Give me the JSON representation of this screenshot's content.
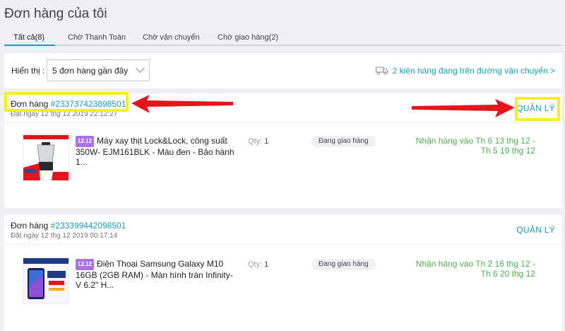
{
  "page": {
    "title": "Đơn hàng của tôi"
  },
  "tabs": [
    {
      "label": "Tất cả(8)"
    },
    {
      "label": "Chờ Thanh Toán"
    },
    {
      "label": "Chờ vận chuyển"
    },
    {
      "label": "Chờ giao hàng(2)"
    }
  ],
  "filter": {
    "label": "Hiển thị :",
    "selected": "5 đơn hàng gần đây",
    "shipping_status": "2 kiện hàng đang trên đường vận chuyển >"
  },
  "orders": [
    {
      "label": "Đơn hàng",
      "id": "#233737423898501",
      "date": "Đặt ngày 12 thg 12 2019 22:12:27",
      "manage": "QUẢN LÝ",
      "item": {
        "badge": "12.12",
        "title": "Máy xay thịt Lock&Lock, công suất 350W- EJM161BLK - Màu đen - Bảo hành 1...",
        "qty_label": "Qty:",
        "qty": "1",
        "status": "Đang giao hàng",
        "delivery": "Nhận hàng vào Th 6 13 thg 12 - Th 5 19 thg 12"
      }
    },
    {
      "label": "Đơn hàng",
      "id": "#233399442098501",
      "date": "Đặt ngày 12 thg 12 2019 00:17:14",
      "manage": "QUẢN LÝ",
      "item": {
        "badge": "12.12",
        "title": "Điện Thoại Samsung Galaxy M10 16GB (2GB RAM) - Màn hình tràn Infinity-V 6.2\" H...",
        "qty_label": "Qty:",
        "qty": "1",
        "status": "Đang giao hàng",
        "delivery": "Nhận hàng vào Th 2 16 thg 12 - Th 6 20 thg 12"
      }
    }
  ],
  "colors": {
    "accent": "#1a9cb7",
    "highlight": "#f4f01a",
    "arrow": "#e8141b",
    "delivery": "#4caf50"
  }
}
